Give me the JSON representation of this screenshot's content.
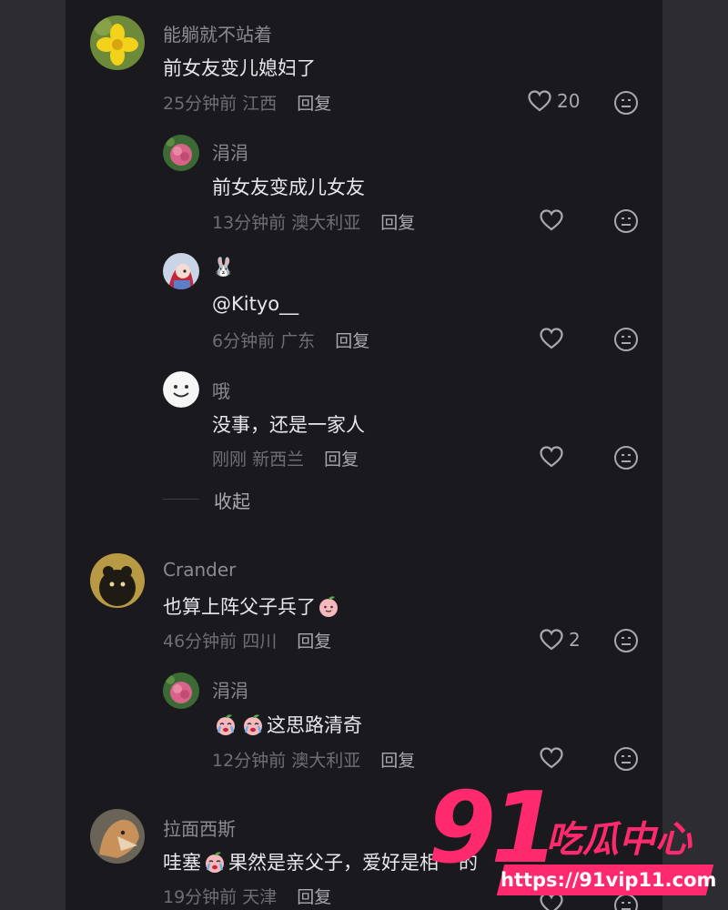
{
  "comments": [
    {
      "user": "能躺就不站着",
      "text": "前女友变儿媳妇了",
      "time": "25分钟前",
      "location": "江西",
      "reply": "回复",
      "likes": "20",
      "replies": [
        {
          "user": "涓涓",
          "text": "前女友变成儿女友",
          "time": "13分钟前",
          "location": "澳大利亚",
          "reply": "回复"
        },
        {
          "user": "🐰",
          "text": "@Kityo__",
          "time": "6分钟前",
          "location": "广东",
          "reply": "回复"
        },
        {
          "user": "哦",
          "text": "没事，还是一家人",
          "time": "刚刚",
          "location": "新西兰",
          "reply": "回复"
        }
      ],
      "collapse": "收起"
    },
    {
      "user": "Crander",
      "text": "也算上阵父子兵了",
      "time": "46分钟前",
      "location": "四川",
      "reply": "回复",
      "likes": "2",
      "replies": [
        {
          "user": "涓涓",
          "text": "这思路清奇",
          "time": "12分钟前",
          "location": "澳大利亚",
          "reply": "回复"
        }
      ]
    },
    {
      "user": "拉面西斯",
      "text_a": "哇塞",
      "text_b": "果然是亲父子，爱好是相",
      "text_c": "的",
      "time": "19分钟前",
      "location": "天津",
      "reply": "回复"
    }
  ],
  "watermark": {
    "logo": "91",
    "brand": "吃瓜中心",
    "url": "https://91vip11.com"
  },
  "colors": {
    "panel": "#1a1a1e",
    "accent": "#ff2a6d"
  }
}
